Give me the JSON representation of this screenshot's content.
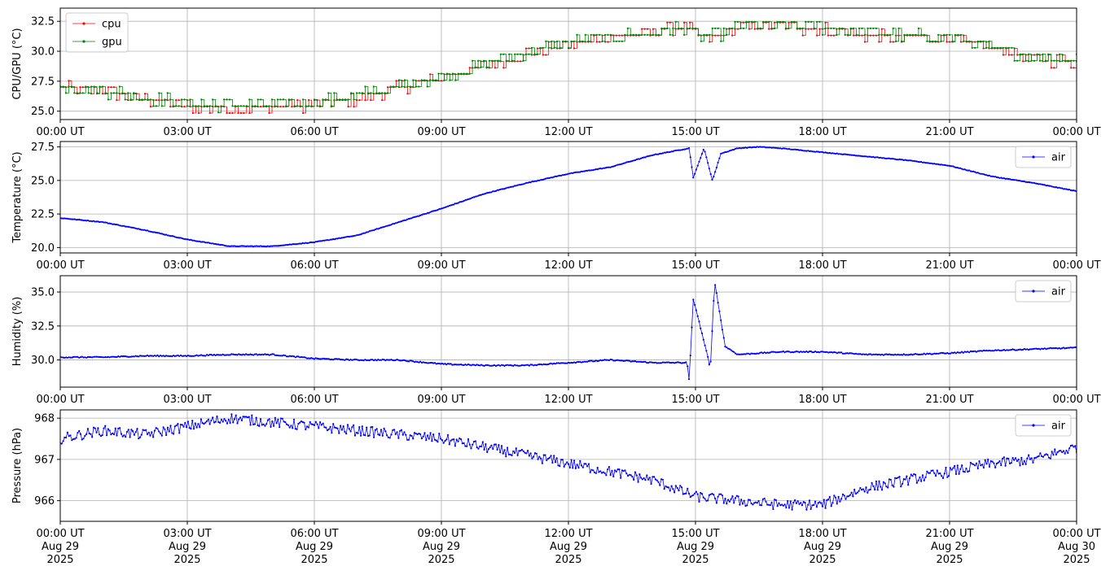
{
  "colors": {
    "cpu": "#ff0000",
    "gpu": "#008000",
    "air": "#0000ff",
    "grid": "#b0b0b0",
    "axis": "#000000"
  },
  "x_ticks": [
    "00:00 UT",
    "03:00 UT",
    "06:00 UT",
    "09:00 UT",
    "12:00 UT",
    "15:00 UT",
    "18:00 UT",
    "21:00 UT",
    "00:00 UT"
  ],
  "x_tick_dates": [
    "Aug 29",
    "Aug 29",
    "Aug 29",
    "Aug 29",
    "Aug 29",
    "Aug 29",
    "Aug 29",
    "Aug 29",
    "Aug 30"
  ],
  "x_tick_years": [
    "2025",
    "2025",
    "2025",
    "2025",
    "2025",
    "2025",
    "2025",
    "2025",
    "2025"
  ],
  "chart_data": [
    {
      "type": "line",
      "ylabel": "CPU/GPU (°C)",
      "xlim": [
        "00:00 UT",
        "00:00 UT"
      ],
      "ylim": [
        24.3,
        33.6
      ],
      "yticks": [
        25.0,
        27.5,
        30.0,
        32.5
      ],
      "ytick_labels": [
        "25.0",
        "27.5",
        "30.0",
        "32.5"
      ],
      "grid": true,
      "legend": "upper-left",
      "x_hours": [
        0,
        1,
        2,
        3,
        4,
        5,
        6,
        7,
        8,
        9,
        10,
        11,
        12,
        13,
        14,
        14.8,
        15,
        15.4,
        16,
        17,
        18,
        19,
        20,
        21,
        22,
        23,
        24
      ],
      "series": [
        {
          "name": "cpu",
          "color": "#ff0000",
          "values": [
            27.0,
            26.7,
            26.0,
            25.4,
            25.2,
            25.2,
            25.6,
            26.0,
            26.9,
            27.8,
            28.7,
            29.8,
            30.6,
            31.1,
            31.7,
            32.1,
            31.2,
            31.0,
            32.0,
            32.1,
            31.8,
            31.3,
            31.1,
            31.1,
            30.2,
            29.3,
            29.1
          ]
        },
        {
          "name": "gpu",
          "color": "#008000",
          "values": [
            27.1,
            26.7,
            26.1,
            25.6,
            25.5,
            25.5,
            25.7,
            26.2,
            27.0,
            27.8,
            28.8,
            29.8,
            30.8,
            31.1,
            31.6,
            32.0,
            31.3,
            31.2,
            32.0,
            32.1,
            31.9,
            31.5,
            31.2,
            31.2,
            30.2,
            29.5,
            29.3
          ]
        }
      ]
    },
    {
      "type": "line",
      "ylabel": "Temperature (°C)",
      "xlim": [
        "00:00 UT",
        "00:00 UT"
      ],
      "ylim": [
        19.6,
        27.9
      ],
      "yticks": [
        20.0,
        22.5,
        25.0,
        27.5
      ],
      "ytick_labels": [
        "20.0",
        "22.5",
        "25.0",
        "27.5"
      ],
      "grid": true,
      "legend": "upper-right",
      "x_hours": [
        0,
        1,
        2,
        3,
        4,
        5,
        6,
        7,
        8,
        9,
        10,
        11,
        12,
        13,
        14,
        14.85,
        14.95,
        15.2,
        15.4,
        15.6,
        16,
        16.5,
        17,
        18,
        19,
        20,
        21,
        22,
        23,
        24
      ],
      "series": [
        {
          "name": "air",
          "color": "#0000ff",
          "values": [
            22.2,
            21.9,
            21.3,
            20.6,
            20.1,
            20.1,
            20.4,
            20.9,
            21.9,
            22.9,
            24.0,
            24.8,
            25.5,
            26.0,
            26.9,
            27.4,
            25.2,
            27.4,
            25.0,
            27.0,
            27.4,
            27.5,
            27.4,
            27.1,
            26.8,
            26.5,
            26.1,
            25.3,
            24.8,
            24.2
          ]
        }
      ]
    },
    {
      "type": "line",
      "ylabel": "Humidity (%)",
      "xlim": [
        "00:00 UT",
        "00:00 UT"
      ],
      "ylim": [
        28.0,
        36.2
      ],
      "yticks": [
        30.0,
        32.5,
        35.0
      ],
      "ytick_labels": [
        "30.0",
        "32.5",
        "35.0"
      ],
      "grid": true,
      "legend": "upper-right",
      "x_hours": [
        0,
        1,
        2,
        3,
        4,
        5,
        6,
        7,
        8,
        9,
        10,
        11,
        12,
        13,
        14,
        14.8,
        14.85,
        14.95,
        15.3,
        15.35,
        15.45,
        15.7,
        16,
        17,
        18,
        19,
        20,
        21,
        22,
        23,
        24
      ],
      "series": [
        {
          "name": "air",
          "color": "#0000ff",
          "values": [
            30.2,
            30.2,
            30.3,
            30.3,
            30.4,
            30.4,
            30.1,
            30.0,
            30.0,
            29.7,
            29.6,
            29.6,
            29.8,
            30.0,
            29.8,
            29.8,
            28.5,
            34.5,
            30.1,
            29.2,
            35.8,
            31.0,
            30.4,
            30.6,
            30.6,
            30.4,
            30.4,
            30.5,
            30.7,
            30.8,
            30.9
          ]
        }
      ]
    },
    {
      "type": "line",
      "ylabel": "Pressure (hPa)",
      "xlim": [
        "00:00 UT",
        "00:00 UT"
      ],
      "ylim": [
        965.5,
        968.2
      ],
      "yticks": [
        966,
        967,
        968
      ],
      "ytick_labels": [
        "966",
        "967",
        "968"
      ],
      "grid": true,
      "legend": "upper-right",
      "x_hours": [
        0,
        1,
        2,
        3,
        4,
        5,
        6,
        7,
        8,
        9,
        10,
        11,
        12,
        13,
        14,
        15,
        16,
        17,
        18,
        19,
        20,
        21,
        22,
        23,
        24
      ],
      "series": [
        {
          "name": "air",
          "color": "#0000ff",
          "values": [
            967.5,
            967.7,
            967.6,
            967.8,
            968.0,
            967.9,
            967.8,
            967.7,
            967.6,
            967.5,
            967.3,
            967.1,
            966.9,
            966.7,
            966.5,
            966.1,
            966.0,
            965.9,
            965.9,
            966.3,
            966.5,
            966.7,
            966.9,
            967.0,
            967.3
          ]
        }
      ]
    }
  ]
}
